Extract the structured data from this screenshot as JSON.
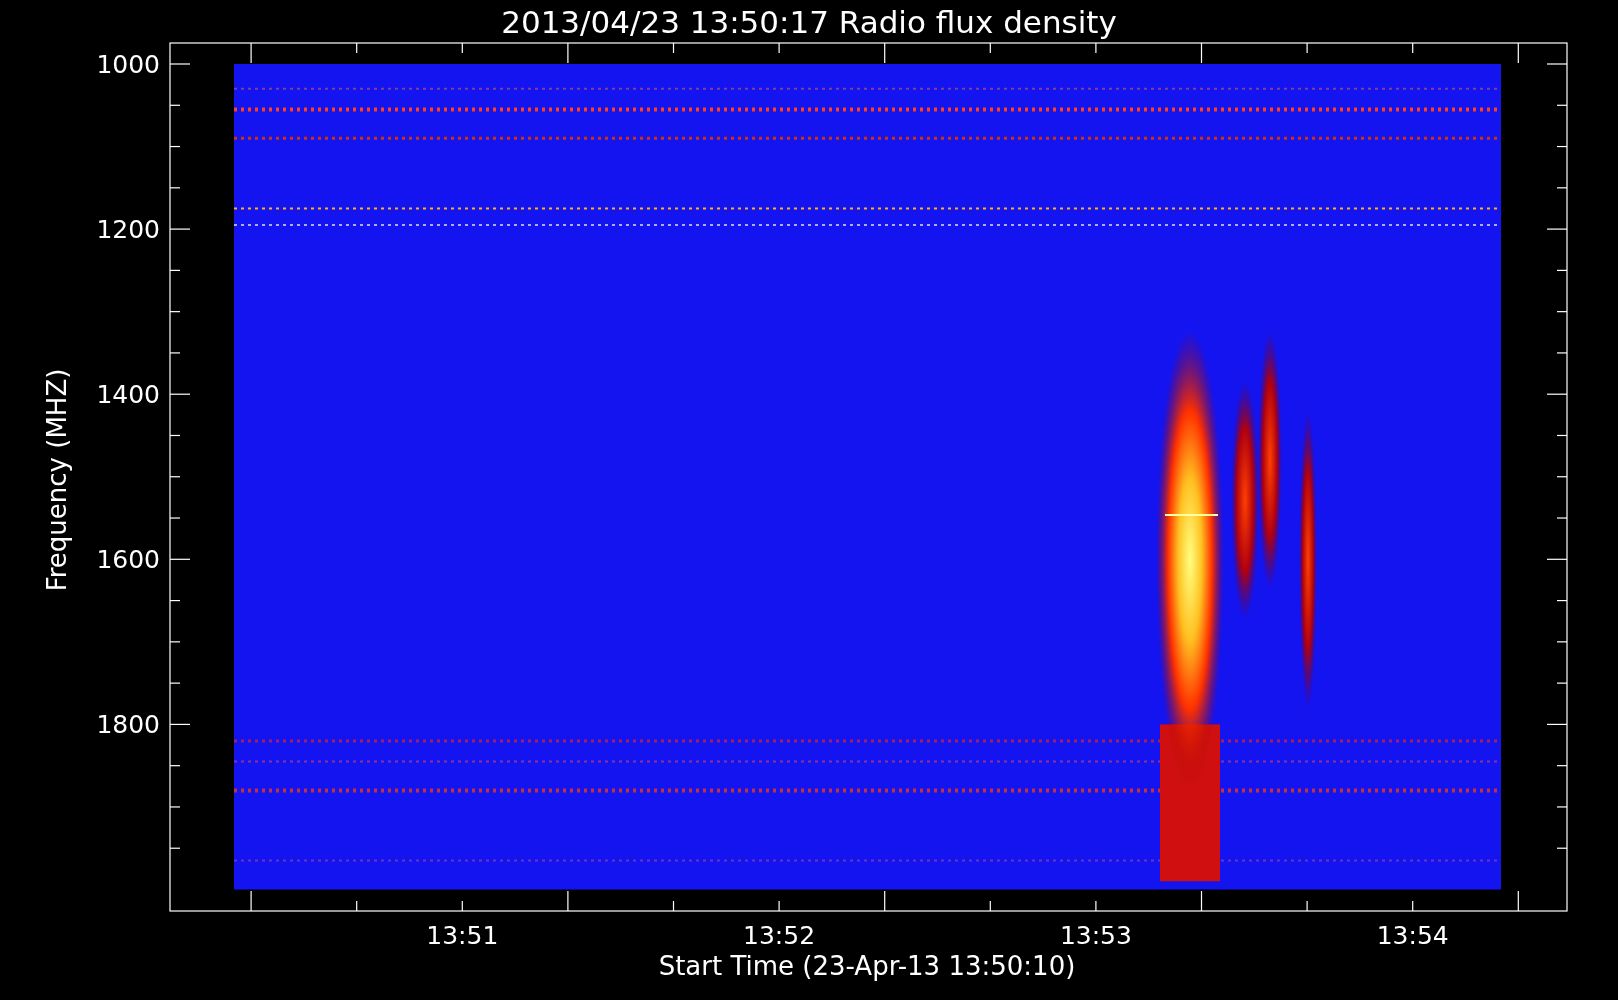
{
  "title": "2013/04/23 13:50:17 Radio flux density",
  "y_axis": {
    "label": "Frequency (MHZ)",
    "ticks": [
      "1000",
      "1200",
      "1400",
      "1600",
      "1800"
    ]
  },
  "x_axis": {
    "label": "Start Time (23-Apr-13 13:50:10)",
    "ticks": [
      "13:51",
      "13:52",
      "13:53",
      "13:54"
    ]
  }
}
